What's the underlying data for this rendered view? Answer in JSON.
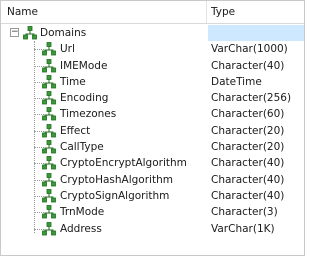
{
  "columns": {
    "name": "Name",
    "type": "Type"
  },
  "root": {
    "label": "Domains",
    "expander": "−",
    "icon": "domain-tree-icon"
  },
  "items": [
    {
      "name": "Url",
      "type": "VarChar(1000)"
    },
    {
      "name": "IMEMode",
      "type": "Character(40)"
    },
    {
      "name": "Time",
      "type": "DateTime"
    },
    {
      "name": "Encoding",
      "type": "Character(256)"
    },
    {
      "name": "Timezones",
      "type": "Character(60)"
    },
    {
      "name": "Effect",
      "type": "Character(20)"
    },
    {
      "name": "CallType",
      "type": "Character(20)"
    },
    {
      "name": "CryptoEncryptAlgorithm",
      "type": "Character(40)"
    },
    {
      "name": "CryptoHashAlgorithm",
      "type": "Character(40)"
    },
    {
      "name": "CryptoSignAlgorithm",
      "type": "Character(40)"
    },
    {
      "name": "TrnMode",
      "type": "Character(3)"
    },
    {
      "name": "Address",
      "type": "VarChar(1K)"
    }
  ],
  "colors": {
    "icon_green": "#3a9a3a",
    "icon_dark": "#1f6e1f",
    "selection": "#cde8ff"
  }
}
